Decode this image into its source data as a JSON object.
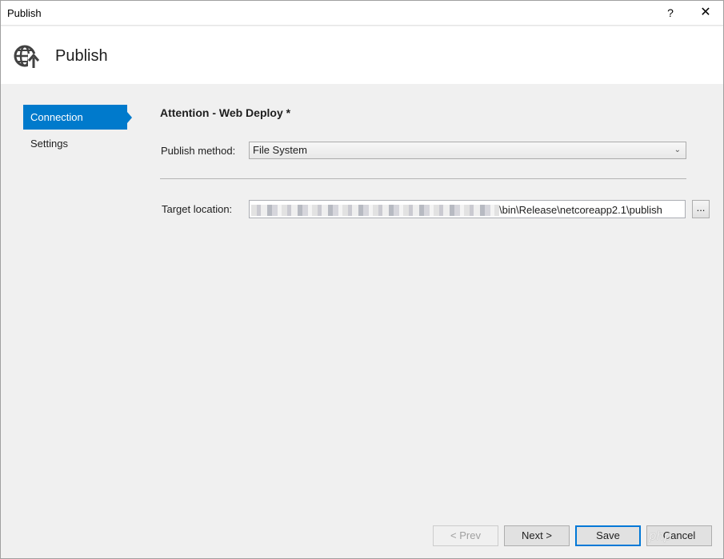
{
  "window": {
    "title": "Publish",
    "help": "?",
    "close": "✕"
  },
  "header": {
    "title": "Publish",
    "icon": "globe-publish-icon"
  },
  "nav": {
    "items": [
      {
        "label": "Connection",
        "active": true
      },
      {
        "label": "Settings",
        "active": false
      }
    ]
  },
  "main": {
    "section_title": "Attention - Web Deploy *",
    "publish_method_label": "Publish method:",
    "publish_method_value": "File System",
    "target_location_label": "Target location:",
    "target_location_visible": "\\bin\\Release\\netcoreapp2.1\\publish",
    "browse_label": "..."
  },
  "footer": {
    "prev": "< Prev",
    "next": "Next >",
    "save": "Save",
    "cancel": "Cancel",
    "watermark": "php"
  },
  "colors": {
    "accent": "#007acc",
    "window_bg": "#f0f0f0"
  }
}
